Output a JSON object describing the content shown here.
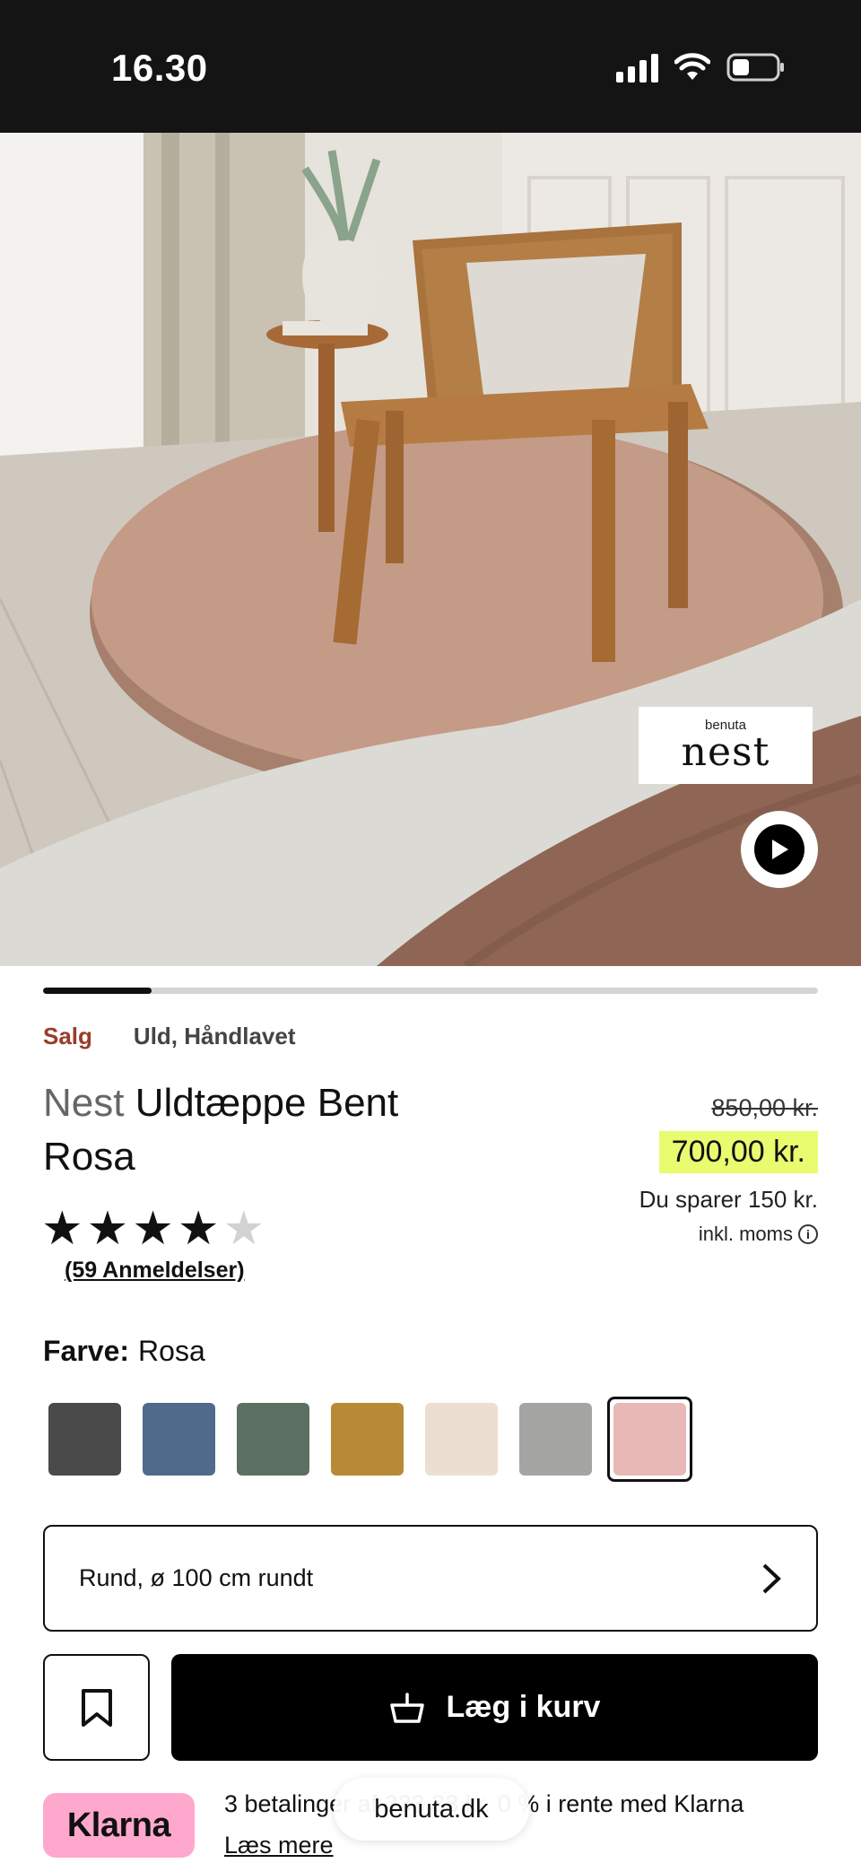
{
  "status_bar": {
    "time": "16.30",
    "icons": [
      "signal-icon",
      "wifi-icon",
      "battery-icon"
    ]
  },
  "hero": {
    "brand_badge_small": "benuta",
    "brand_badge_big": "nest",
    "play_icon": "play-icon"
  },
  "gallery": {
    "progress": 0.14
  },
  "tags": {
    "sale": "Salg",
    "material": "Uld, Håndlavet"
  },
  "product": {
    "brand": "Nest",
    "name_line1": "Uldtæppe Bent",
    "name_line2": "Rosa",
    "old_price": "850,00 kr.",
    "new_price": "700,00 kr.",
    "savings": "Du sparer 150 kr.",
    "vat": "inkl. moms",
    "rating": 4,
    "rating_max": 5,
    "reviews": "(59 Anmeldelser)"
  },
  "color": {
    "label": "Farve:",
    "selected": "Rosa",
    "swatches": [
      "#4a4a4a",
      "#4f6a8a",
      "#5b7062",
      "#b98a35",
      "#ecdfd2",
      "#a4a4a2",
      "#e7b8b6"
    ],
    "selected_index": 6
  },
  "size": {
    "value": "Rund, ø 100 cm rundt",
    "icon": "chevron-right-icon"
  },
  "actions": {
    "wishlist_icon": "bookmark-icon",
    "add_to_cart": "Læg i kurv",
    "cart_icon": "basket-icon"
  },
  "klarna": {
    "logo": "Klarna",
    "text": "3 betalinger af 233,33 kr. 0 % i rente med Klarna",
    "link": "Læs mere"
  },
  "browser": {
    "url": "benuta.dk"
  },
  "colors": {
    "accent_highlight": "#e9fb6f",
    "sale_text": "#9b3b2a",
    "klarna_pink": "#ffa8cd"
  }
}
